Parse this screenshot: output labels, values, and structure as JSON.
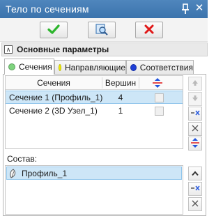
{
  "window": {
    "title": "Тело по сечениям"
  },
  "toolbar": {
    "ok": "check-icon",
    "preview": "preview-icon",
    "cancel": "cancel-x-icon"
  },
  "section": {
    "label": "Основные параметры"
  },
  "tabs": [
    {
      "label": "Сечения",
      "color": "#7ed47e",
      "active": true
    },
    {
      "label": "Направляющие",
      "color": "#f5f000",
      "active": false
    },
    {
      "label": "Соответствия",
      "color": "#1e3fd8",
      "active": false
    }
  ],
  "grid": {
    "columns": [
      "Сечения",
      "Вершин"
    ],
    "rows": [
      {
        "name": "Сечение 1 (Профиль_1)",
        "vertices": "4",
        "selected": true
      },
      {
        "name": "Сечение 2 (3D Узел_1)",
        "vertices": "1",
        "selected": false
      }
    ]
  },
  "composition": {
    "label": "Состав:",
    "items": [
      {
        "name": "Профиль_1",
        "icon": "sketch-leaf-icon"
      }
    ]
  },
  "colors": {
    "titlebar": "#4379b2",
    "selection": "#cde6f7",
    "ok_green": "#2db52d",
    "cancel_red": "#e01818"
  }
}
